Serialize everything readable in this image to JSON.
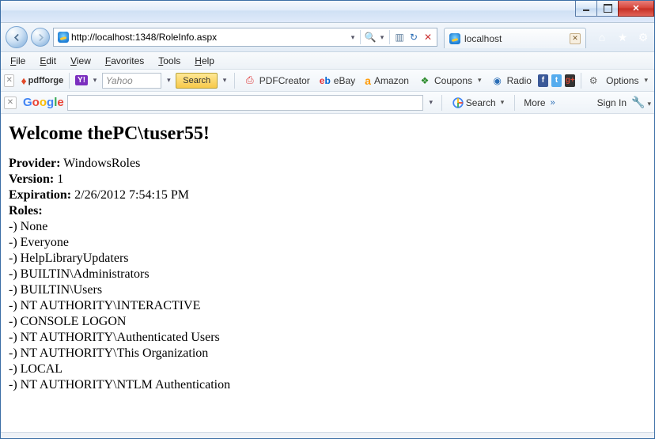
{
  "tab": {
    "title": "localhost"
  },
  "address": {
    "url": "http://localhost:1348/RoleInfo.aspx"
  },
  "menus": {
    "file": "File",
    "edit": "Edit",
    "view": "View",
    "favorites": "Favorites",
    "tools": "Tools",
    "help": "Help"
  },
  "tb1": {
    "pdfforge": "pdfforge",
    "yahoo_placeholder": "Yahoo",
    "search_btn": "Search",
    "pdfcreator": "PDFCreator",
    "ebay_prefix": "e",
    "ebay_suffix": "b",
    "ebay_label": "eBay",
    "amazon": "Amazon",
    "coupons": "Coupons",
    "radio": "Radio",
    "options": "Options"
  },
  "tb2": {
    "google": {
      "g1": "G",
      "o1": "o",
      "o2": "o",
      "g2": "g",
      "l": "l",
      "e": "e"
    },
    "search": "Search",
    "more": "More",
    "signin": "Sign In"
  },
  "page": {
    "heading": "Welcome thePC\\tuser55!",
    "provider_lbl": "Provider:",
    "provider_val": " WindowsRoles",
    "version_lbl": "Version:",
    "version_val": " 1",
    "expiration_lbl": "Expiration:",
    "expiration_val": " 2/26/2012 7:54:15 PM",
    "roles_lbl": "Roles:",
    "roles": [
      "-) None",
      "-) Everyone",
      "-) HelpLibraryUpdaters",
      "-) BUILTIN\\Administrators",
      "-) BUILTIN\\Users",
      "-) NT AUTHORITY\\INTERACTIVE",
      "-) CONSOLE LOGON",
      "-) NT AUTHORITY\\Authenticated Users",
      "-) NT AUTHORITY\\This Organization",
      "-) LOCAL",
      "-) NT AUTHORITY\\NTLM Authentication"
    ]
  }
}
